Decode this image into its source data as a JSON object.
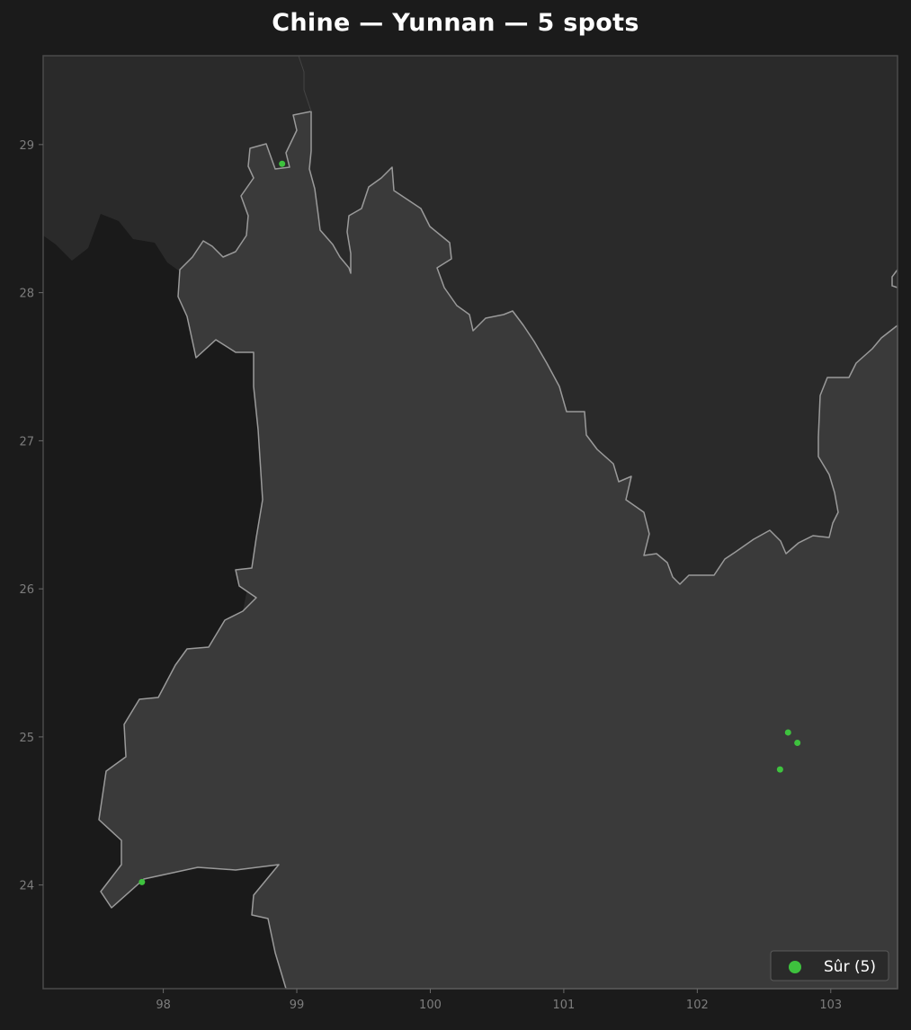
{
  "title": "Chine — Yunnan — 5 spots",
  "colors": {
    "background": "#1b1b1b",
    "neighbor_region": "#2a2a2a",
    "outside_region": "#1a1a1a",
    "province_fill": "#3a3a3a",
    "province_border": "#9a9a9a",
    "frame": "#4a4a4a",
    "spot": "#3ec23e",
    "tick_text": "#7d7d7d"
  },
  "chart_data": {
    "type": "scatter",
    "xlim": [
      97.1,
      103.5
    ],
    "ylim": [
      23.3,
      29.6
    ],
    "x_ticks": [
      "98",
      "99",
      "100",
      "101",
      "102",
      "103"
    ],
    "y_ticks": [
      "24",
      "25",
      "26",
      "27",
      "28",
      "29"
    ],
    "legend_placement": "bottom-right",
    "series": [
      {
        "name": "Sûr (5)",
        "color": "#3ec23e",
        "points": [
          {
            "lon": 98.89,
            "lat": 28.87
          },
          {
            "lon": 102.68,
            "lat": 25.03
          },
          {
            "lon": 102.75,
            "lat": 24.96
          },
          {
            "lon": 102.62,
            "lat": 24.78
          },
          {
            "lon": 97.84,
            "lat": 24.02
          }
        ]
      }
    ]
  },
  "legend": {
    "label": "Sûr (5)"
  }
}
